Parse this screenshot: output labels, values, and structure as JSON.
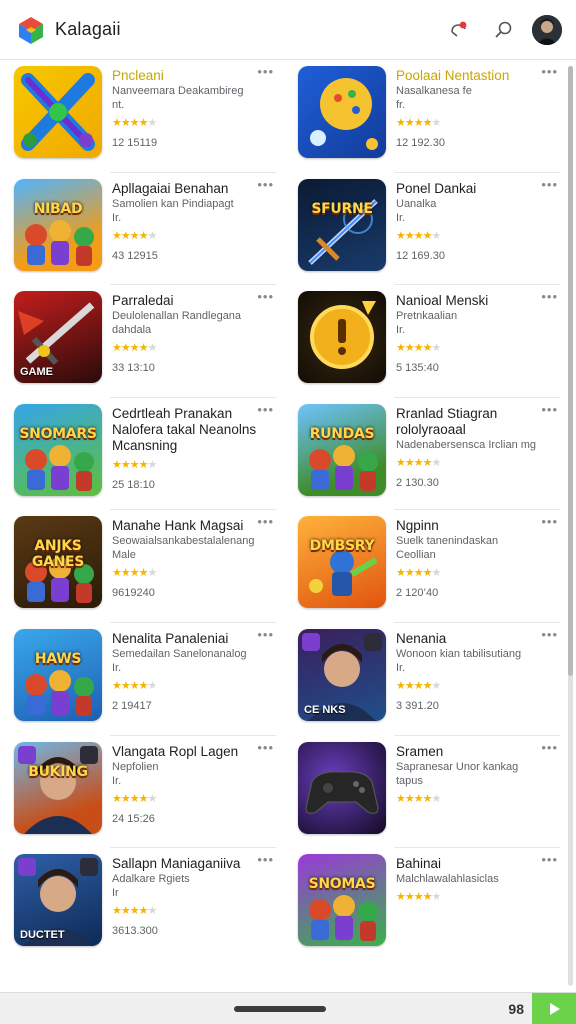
{
  "header": {
    "title": "Kalagaii",
    "icons": [
      "app-logo-icon",
      "notification-icon",
      "search-icon",
      "avatar"
    ]
  },
  "apps": [
    {
      "title": "Pncleani",
      "title_color": "#c8a600",
      "sub1": "Nanveemara Deakambireg",
      "sub2": "nt.",
      "rating": 4,
      "meta": "12 15119",
      "thumb": {
        "bg": "linear-gradient(135deg,#f6c800,#f0a800)",
        "label": "",
        "banner": "",
        "art": "x"
      }
    },
    {
      "title": "Poolaai Nentastion",
      "title_color": "#c8a600",
      "sub1": "Nasalkanesa fe",
      "sub2": "fr.",
      "rating": 4,
      "meta": "12 192.30",
      "thumb": {
        "bg": "linear-gradient(135deg,#1f5fd8,#123b9a)",
        "label": "",
        "banner": "",
        "art": "ball"
      }
    },
    {
      "title": "Apllagaiai Benahan",
      "title_color": "#1f1f1f",
      "sub1": "Samolien kan Pindiapagt",
      "sub2": "Ir.",
      "rating": 4,
      "meta": "43 12915",
      "thumb": {
        "bg": "linear-gradient(160deg,#4fb4ff,#f29c1a 70%)",
        "label": "",
        "banner": "NIBAD",
        "art": "heroes"
      }
    },
    {
      "title": "Ponel Dankai",
      "title_color": "#1f1f1f",
      "sub1": "Uanalka",
      "sub2": "Ir.",
      "rating": 4,
      "meta": "12 169.30",
      "thumb": {
        "bg": "linear-gradient(160deg,#0b1a33,#183b6b)",
        "label": "",
        "banner": "SFURNE",
        "art": "sword"
      }
    },
    {
      "title": "Parraledai",
      "title_color": "#1f1f1f",
      "sub1": "Deulolenallan Randlegana",
      "sub2": "dahdala",
      "rating": 4,
      "meta": "33 13:10",
      "thumb": {
        "bg": "linear-gradient(160deg,#c41d1d,#2a0b0b)",
        "label": "GAME",
        "banner": "",
        "art": "blade"
      }
    },
    {
      "title": "Nanioal Menski",
      "title_color": "#1f1f1f",
      "sub1": "Pretnkaalian",
      "sub2": "Ir.",
      "rating": 4,
      "meta": "5 135:40",
      "thumb": {
        "bg": "radial-gradient(circle at 50% 50%,#3a2a12,#120c05)",
        "label": "",
        "banner": "",
        "art": "coin"
      }
    },
    {
      "title": "Cedrtleah Pranakan Nalofera takal Neanolns Mcansning",
      "title_color": "#1f1f1f",
      "sub1": "",
      "sub2": "",
      "rating": 4,
      "meta": "25 18:10",
      "thumb": {
        "bg": "linear-gradient(160deg,#35a6e8,#5fbf3a)",
        "label": "",
        "banner": "SNOMARS",
        "art": "heroes"
      }
    },
    {
      "title": "Rranlad Stiagran rololyraoaal",
      "title_color": "#1f1f1f",
      "sub1": "Nadenabersensca Irclian mg",
      "sub2": "",
      "rating": 4,
      "meta": "2 130.30",
      "thumb": {
        "bg": "linear-gradient(160deg,#6ec3ff,#3f8c2b 75%)",
        "label": "",
        "banner": "RUNDAS",
        "art": "heroes"
      }
    },
    {
      "title": "Manahe Hank Magsai",
      "title_color": "#1f1f1f",
      "sub1": "Seowaialsankabestalalenang",
      "sub2": "Male",
      "rating": 4,
      "meta": "9619240",
      "thumb": {
        "bg": "linear-gradient(160deg,#5a3a14,#2a1a08)",
        "label": "",
        "banner": "ANJKS GANES",
        "art": "heroes"
      }
    },
    {
      "title": "Ngpinn",
      "title_color": "#1f1f1f",
      "sub1": "Suelk tanenindaskan",
      "sub2": "Ceollian",
      "rating": 4,
      "meta": "2 120’40",
      "thumb": {
        "bg": "linear-gradient(160deg,#ffb23b,#e0540f)",
        "label": "",
        "banner": "DMBSRY",
        "art": "robot"
      }
    },
    {
      "title": "Nenalita Panaleniai",
      "title_color": "#1f1f1f",
      "sub1": "Semedailan Sanelonanalog",
      "sub2": "Ir.",
      "rating": 4,
      "meta": "2 19417",
      "thumb": {
        "bg": "linear-gradient(160deg,#3aa8ea,#1d5fb3)",
        "label": "",
        "banner": "HAWS",
        "art": "heroes"
      }
    },
    {
      "title": "Nenania",
      "title_color": "#1f1f1f",
      "sub1": "Wonoon kian tabilisutiang",
      "sub2": "Ir.",
      "rating": 4,
      "meta": "3 391.20",
      "thumb": {
        "bg": "linear-gradient(160deg,#3a1f5c,#1f4f8a)",
        "label": "CE NKS",
        "banner": "",
        "art": "portrait"
      }
    },
    {
      "title": "Vlangata Ropl Lagen",
      "title_color": "#1f1f1f",
      "sub1": "Nepfolien",
      "sub2": "Ir.",
      "rating": 4,
      "meta": "24 15:26",
      "thumb": {
        "bg": "linear-gradient(160deg,#6fb7e8,#c94d16 75%)",
        "label": "",
        "banner": "BUKING",
        "art": "portrait"
      }
    },
    {
      "title": "Sramen",
      "title_color": "#1f1f1f",
      "sub1": "Sapranesar Unor kankag",
      "sub2": "tapus",
      "rating": 4,
      "meta": "",
      "thumb": {
        "bg": "radial-gradient(circle at 40% 40%,#6a3fc0,#120a22)",
        "label": "",
        "banner": "",
        "art": "pad"
      }
    },
    {
      "title": "Sallapn Maniaganiiva",
      "title_color": "#1f1f1f",
      "sub1": "Adalkare Rgiets",
      "sub2": "Ir",
      "rating": 4,
      "meta": "3613.300",
      "thumb": {
        "bg": "linear-gradient(160deg,#2f5fa8,#0e2a55)",
        "label": "DUCTET",
        "banner": "",
        "art": "portrait"
      }
    },
    {
      "title": "Bahinai",
      "title_color": "#1f1f1f",
      "sub1": "Malchlawalahlasiclas",
      "sub2": "",
      "rating": 4,
      "meta": "",
      "thumb": {
        "bg": "linear-gradient(160deg,#9a3ad8,#39b24a)",
        "label": "",
        "banner": "SNOMAS",
        "art": "heroes"
      }
    }
  ],
  "footer": {
    "count": "98"
  },
  "colors": {
    "star": "#f5b400",
    "accent": "#6ad34a"
  }
}
